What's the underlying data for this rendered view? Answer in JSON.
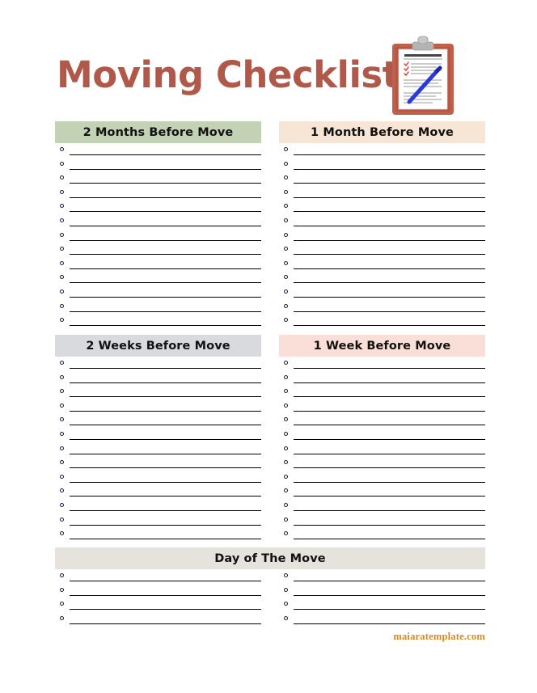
{
  "document": {
    "title": "Moving Checklist",
    "title_color": "#b0584a",
    "background_color": "#ffffff"
  },
  "clipboard_icon": {
    "name": "clipboard-icon",
    "board_color": "#c0604c",
    "clip_color": "#b4b4b4",
    "paper_color": "#ffffff",
    "paper_heading": "MOVING CHECKLIST",
    "check_color": "#d83a2a",
    "pen_color": "#2a3ad8",
    "line_color": "#9a9a9a"
  },
  "sections": [
    {
      "id": "two-months-before-move",
      "label": "2 Months Before Move",
      "bar_color": "#c3d1b4",
      "rows": 13,
      "column": "left",
      "span": "half"
    },
    {
      "id": "one-month-before-move",
      "label": "1 Month Before Move",
      "bar_color": "#f7e6d5",
      "rows": 13,
      "column": "right",
      "span": "half"
    },
    {
      "id": "two-weeks-before-move",
      "label": "2 Weeks Before Move",
      "bar_color": "#d8dade",
      "rows": 13,
      "column": "left",
      "span": "half"
    },
    {
      "id": "one-week-before-move",
      "label": "1 Week Before Move",
      "bar_color": "#fadfd8",
      "rows": 13,
      "column": "right",
      "span": "half"
    },
    {
      "id": "day-of-the-move",
      "label": "Day of The Move",
      "bar_color": "#e6e2dc",
      "rows": 4,
      "column": "both",
      "span": "full"
    }
  ],
  "footer": {
    "watermark": "maiaratemplate.com",
    "color": "#d78a23"
  }
}
